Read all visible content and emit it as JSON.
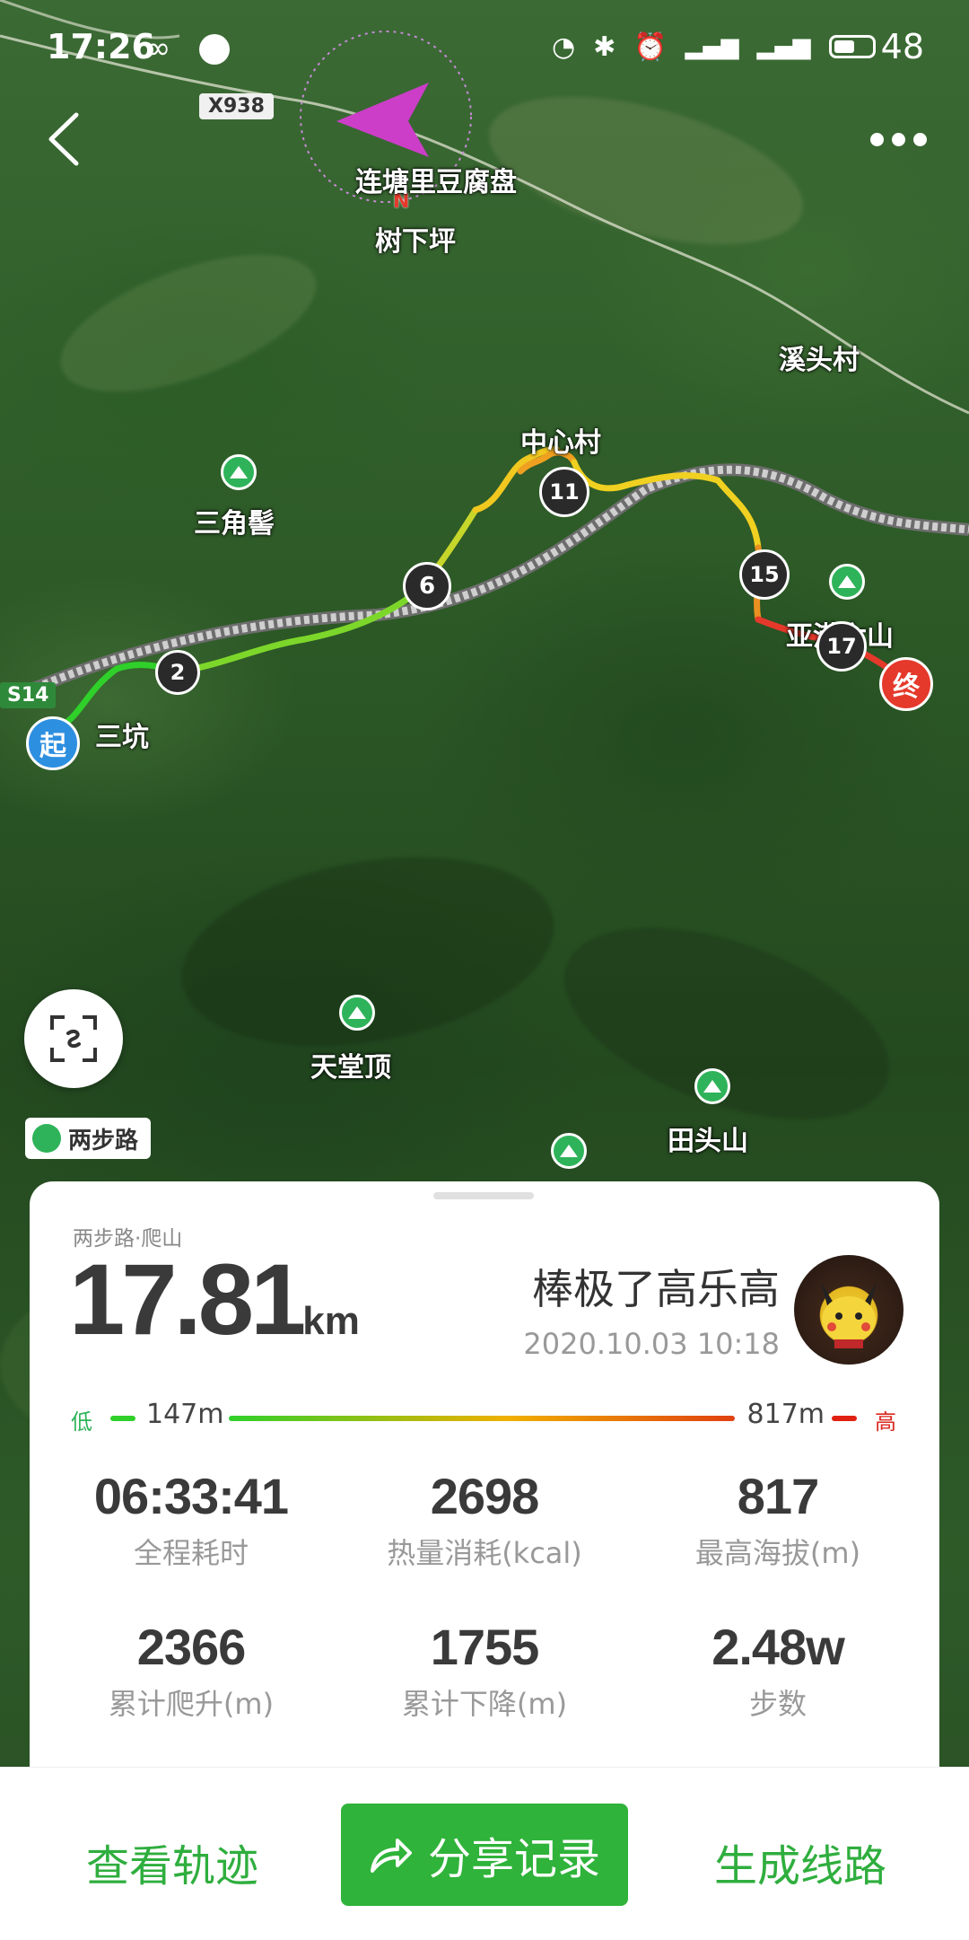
{
  "status_bar": {
    "time": "17:26",
    "battery": "48"
  },
  "map": {
    "labels": {
      "road_x938": "X938",
      "road_s14": "S14",
      "lianbang": "连塘里豆腐盘",
      "shuxiaping": "树下坪",
      "xitoucun": "溪头村",
      "zhongxincun": "中心村",
      "sanjiaoji": "三角髻",
      "sankeng": "三坑",
      "yagangliushan": "亚港六山",
      "tiantangding": "天堂顶",
      "tiantoushan": "田头山"
    },
    "compass_n": "N",
    "start_marker": "起",
    "end_marker": "终",
    "waypoints": [
      "2",
      "6",
      "11",
      "15",
      "17"
    ]
  },
  "logo_text": "两步路",
  "card": {
    "category": "两步路·爬山",
    "distance_value": "17.81",
    "distance_unit": "km",
    "username": "棒极了高乐高",
    "datetime": "2020.10.03 10:18",
    "elevation": {
      "low_label": "低",
      "low_value": "147m",
      "high_value": "817m",
      "high_label": "高"
    },
    "stats": [
      {
        "value": "06:33:41",
        "label": "全程耗时"
      },
      {
        "value": "2698",
        "label": "热量消耗(kcal)"
      },
      {
        "value": "817",
        "label": "最高海拔(m)"
      },
      {
        "value": "2366",
        "label": "累计爬升(m)"
      },
      {
        "value": "1755",
        "label": "累计下降(m)"
      },
      {
        "value": "2.48w",
        "label": "步数"
      }
    ]
  },
  "bottom_bar": {
    "view_track": "查看轨迹",
    "share_record": "分享记录",
    "generate_route": "生成线路"
  },
  "colors": {
    "accent_green": "#2fb33a",
    "start_blue": "#2d8fe0",
    "end_red": "#e5392b"
  }
}
